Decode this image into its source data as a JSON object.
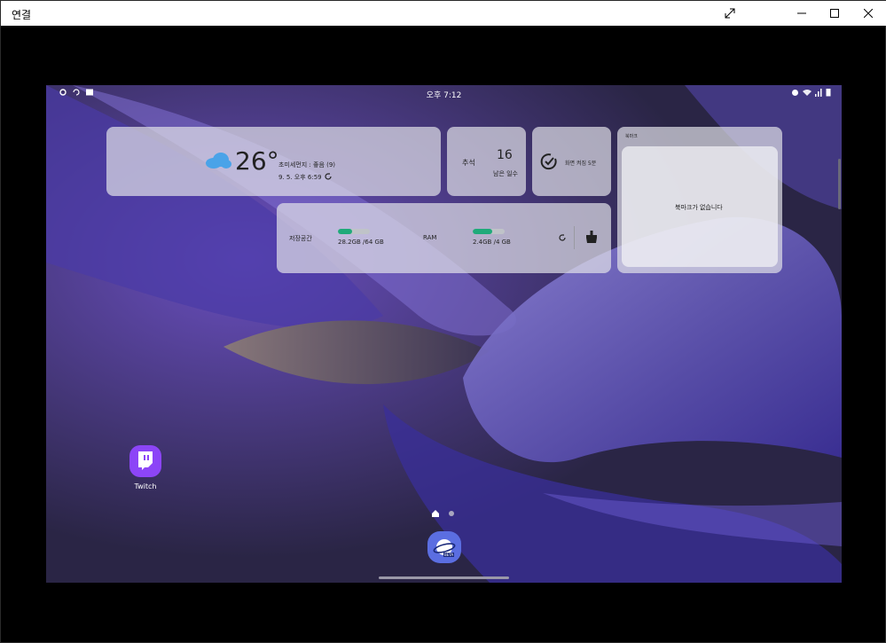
{
  "window": {
    "title": "연결"
  },
  "statusbar": {
    "time": "오후 7:12"
  },
  "weather": {
    "temperature": "26°",
    "air_quality": "초미세먼지 : 좋음 (9)",
    "updated": "9. 5. 오후 6:59"
  },
  "countdown": {
    "label": "추석",
    "days": "16",
    "sublabel": "남은 일수"
  },
  "screen_time": {
    "label": "화면 켜짐 5분"
  },
  "bookmark": {
    "title": "북마크",
    "empty_text": "북마크가 없습니다"
  },
  "device_care": {
    "storage_label": "저장공간",
    "storage_value": "28.2GB /64 GB",
    "storage_fraction": 0.44,
    "ram_label": "RAM",
    "ram_value": "2.4GB /4 GB",
    "ram_fraction": 0.6
  },
  "apps": [
    {
      "label": "Twitch"
    }
  ],
  "dock": {
    "beta_badge": "BETA"
  },
  "colors": {
    "accent_green": "#1faa7a",
    "twitch_purple": "#8c45f7",
    "internet_blue": "#5b6ee1"
  }
}
